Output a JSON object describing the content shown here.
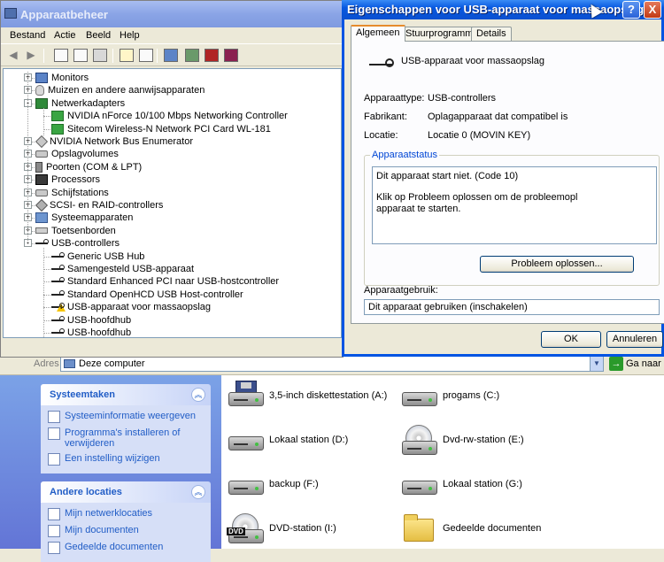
{
  "explorer": {
    "address_label": "Adres",
    "address_value": "Deze computer",
    "go_label": "Ga naar",
    "taskpane": {
      "system_title": "Systeemtaken",
      "system_items": [
        "Systeeminformatie weergeven",
        "Programma's installeren of verwijderen",
        "Een instelling wijzigen"
      ],
      "other_title": "Andere locaties",
      "other_items": [
        "Mijn netwerklocaties",
        "Mijn documenten",
        "Gedeelde documenten"
      ]
    },
    "drives": [
      {
        "label": "3,5-inch diskettestation (A:)",
        "icon": "floppy-icon"
      },
      {
        "label": "progams (C:)",
        "icon": "hard-drive-icon"
      },
      {
        "label": "Lokaal station (D:)",
        "icon": "hard-drive-icon"
      },
      {
        "label": "Dvd-rw-station (E:)",
        "icon": "cd-drive-icon"
      },
      {
        "label": "backup (F:)",
        "icon": "hard-drive-icon"
      },
      {
        "label": "Lokaal station (G:)",
        "icon": "hard-drive-icon"
      },
      {
        "label": "DVD-station (I:)",
        "icon": "dvd-drive-icon"
      },
      {
        "label": "Gedeelde documenten",
        "icon": "folder-icon"
      }
    ],
    "dvd_badge": "DVD"
  },
  "devmgr": {
    "title": "Apparaatbeheer",
    "menu": [
      "Bestand",
      "Actie",
      "Beeld",
      "Help"
    ],
    "tree": [
      {
        "label": "Monitors",
        "icon": "monitor-icon"
      },
      {
        "label": "Muizen en andere aanwijsapparaten",
        "icon": "mouse-icon"
      },
      {
        "label": "Netwerkadapters",
        "icon": "network-icon"
      },
      {
        "label": "NVIDIA nForce 10/100 Mbps Networking Controller",
        "icon": "nic-icon"
      },
      {
        "label": "Sitecom Wireless-N Network PCI Card WL-181",
        "icon": "nic-icon"
      },
      {
        "label": "NVIDIA Network Bus Enumerator",
        "icon": "bus-icon"
      },
      {
        "label": "Opslagvolumes",
        "icon": "disk-icon"
      },
      {
        "label": "Poorten (COM & LPT)",
        "icon": "port-icon"
      },
      {
        "label": "Processors",
        "icon": "cpu-icon"
      },
      {
        "label": "Schijfstations",
        "icon": "disk-icon"
      },
      {
        "label": "SCSI- en RAID-controllers",
        "icon": "scsi-icon"
      },
      {
        "label": "Systeemapparaten",
        "icon": "system-icon"
      },
      {
        "label": "Toetsenborden",
        "icon": "keyboard-icon"
      },
      {
        "label": "USB-controllers",
        "icon": "usb-icon"
      },
      {
        "label": "Generic USB Hub",
        "icon": "usb-icon"
      },
      {
        "label": "Samengesteld USB-apparaat",
        "icon": "usb-icon"
      },
      {
        "label": "Standard Enhanced PCI naar USB-hostcontroller",
        "icon": "usb-icon"
      },
      {
        "label": "Standard OpenHCD USB Host-controller",
        "icon": "usb-icon"
      },
      {
        "label": "USB-apparaat voor massaopslag",
        "icon": "usb-warning-icon"
      },
      {
        "label": "USB-hoofdhub",
        "icon": "usb-icon"
      },
      {
        "label": "USB-hoofdhub",
        "icon": "usb-icon"
      }
    ]
  },
  "props": {
    "title": "Eigenschappen voor USB-apparaat voor massaopslag",
    "help": "?",
    "close": "X",
    "tabs": [
      "Algemeen",
      "Stuurprogramma",
      "Details"
    ],
    "device_name": "USB-apparaat voor massaopslag",
    "fields": [
      {
        "label": "Apparaattype:",
        "value": "USB-controllers"
      },
      {
        "label": "Fabrikant:",
        "value": "Oplagapparaat dat compatibel is"
      },
      {
        "label": "Locatie:",
        "value": "Locatie 0 (MOVIN KEY)"
      }
    ],
    "status_title": "Apparaatstatus",
    "status_line1": "Dit apparaat start niet. (Code 10)",
    "status_line2": "Klik op Probleem oplossen om de probleemopl",
    "status_line3": "apparaat te starten.",
    "troubleshoot_label": "Probleem oplossen...",
    "usage_label": "Apparaatgebruik:",
    "usage_value": "Dit apparaat gebruiken (inschakelen)",
    "ok_label": "OK",
    "cancel_label": "Annuleren"
  }
}
